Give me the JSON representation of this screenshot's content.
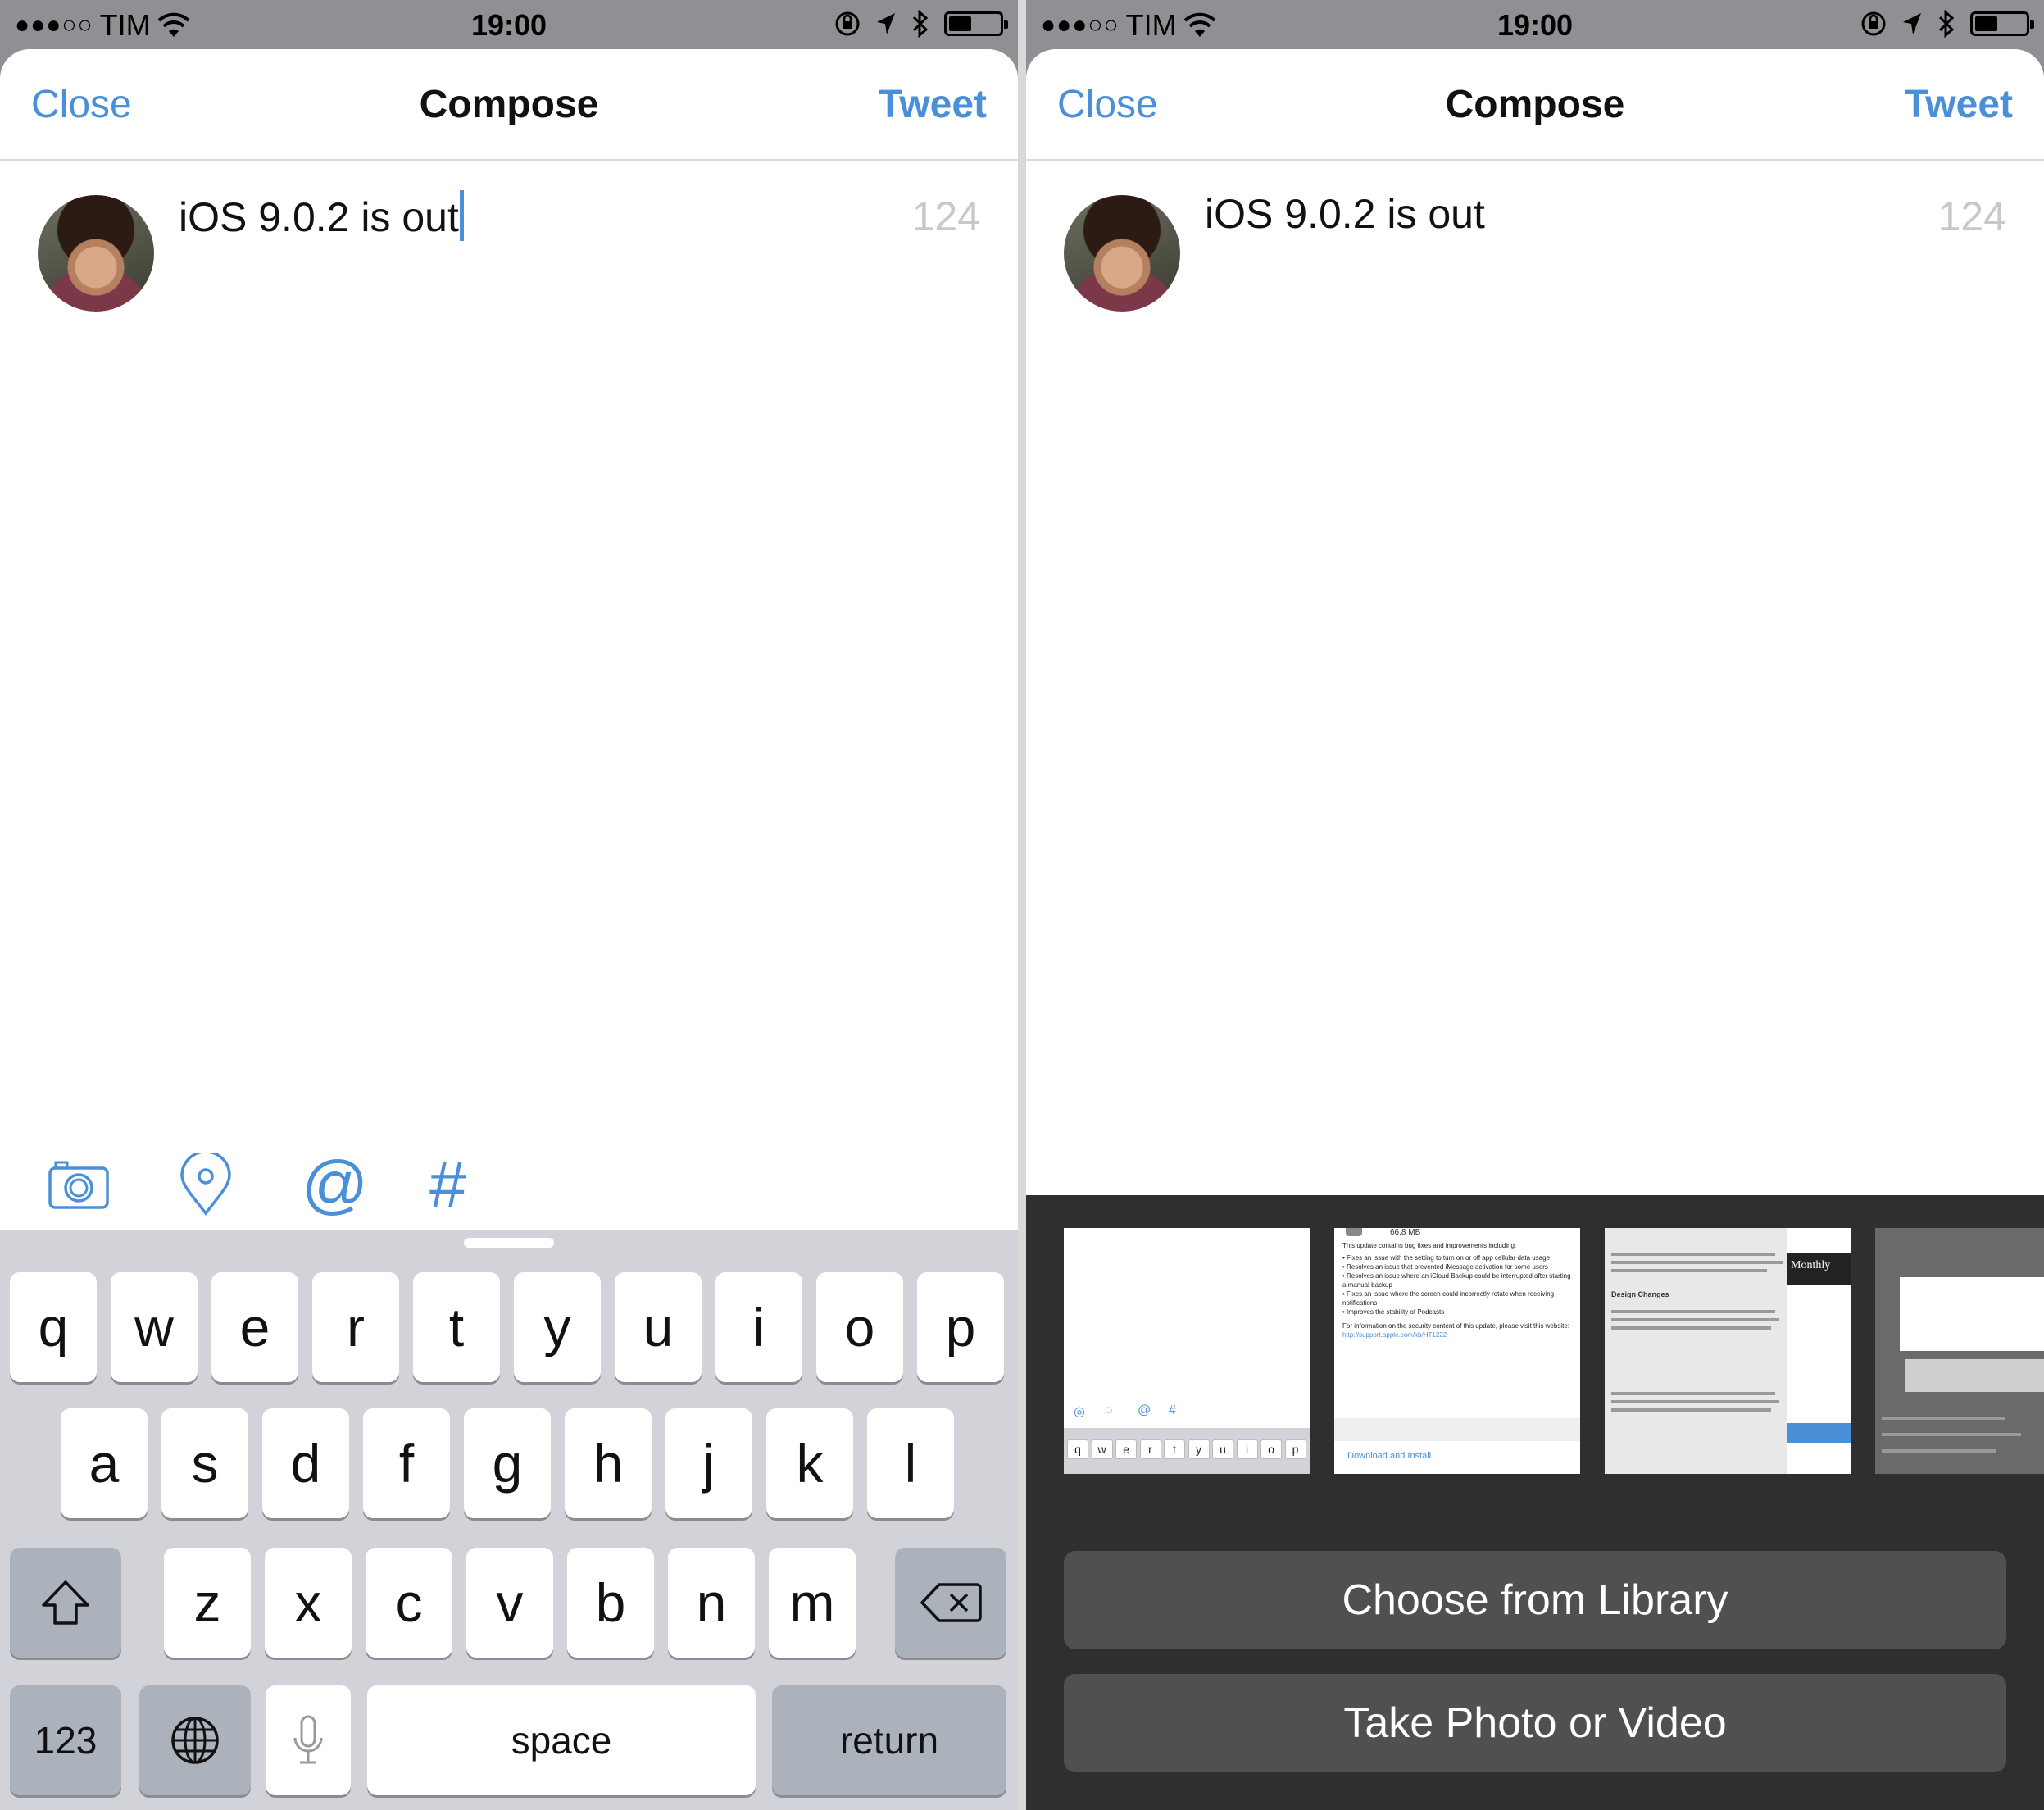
{
  "status_bar": {
    "carrier": "TIM",
    "time": "19:00",
    "battery_level": 0.45
  },
  "compose": {
    "close_label": "Close",
    "title": "Compose",
    "tweet_label": "Tweet",
    "tweet_text": "iOS 9.0.2 is out",
    "char_count": "124"
  },
  "accessory_icons": [
    "camera-icon",
    "location-pin-icon",
    "at-icon",
    "hashtag-icon"
  ],
  "icon_glyphs": {
    "at": "@",
    "hash": "#"
  },
  "keyboard": {
    "row1": [
      "q",
      "w",
      "e",
      "r",
      "t",
      "y",
      "u",
      "i",
      "o",
      "p"
    ],
    "row2": [
      "a",
      "s",
      "d",
      "f",
      "g",
      "h",
      "j",
      "k",
      "l"
    ],
    "row3": [
      "z",
      "x",
      "c",
      "v",
      "b",
      "n",
      "m"
    ],
    "numbers_label": "123",
    "space_label": "space",
    "return_label": "return"
  },
  "photo_picker": {
    "choose_library_label": "Choose from Library",
    "take_photo_label": "Take Photo or Video",
    "thumb_keyboard_row": [
      "q",
      "w",
      "e",
      "r",
      "t",
      "y",
      "u",
      "i",
      "o",
      "p"
    ],
    "thumb2_size": "66,8 MB",
    "thumb2_intro": "This update contains bug fixes and improvements including:",
    "thumb2_bullets": [
      "Fixes an issue with the setting to turn on or off app cellular data usage",
      "Resolves an issue that prevented iMessage activation for some users",
      "Resolves an issue where an iCloud Backup could be interrupted after starting a manual backup",
      "Fixes an issue where the screen could incorrectly rotate when receiving notifications",
      "Improves the stability of Podcasts"
    ],
    "thumb2_security": "For information on the security content of this update, please visit this website:",
    "thumb2_link": "http://support.apple.com/kb/HT1222",
    "thumb2_download": "Download and Install",
    "thumb3_heading": "Design Changes",
    "thumb3_badge": "Monthly"
  },
  "colors": {
    "accent": "#4a90d9",
    "keyboard_bg": "#d1d3d9",
    "panel_bg": "#2f2f2f",
    "panel_button": "#505050"
  }
}
